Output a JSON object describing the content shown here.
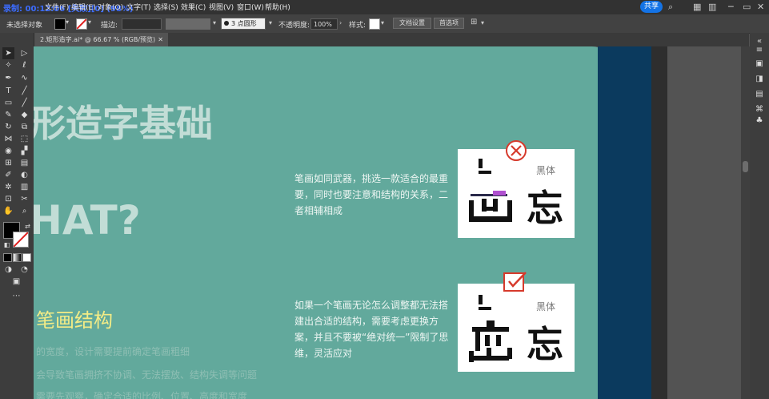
{
  "menubar": {
    "recording": "录制: 00:12:06 [失败][0] (98%)",
    "items": [
      "文件(F)",
      "编辑(E)",
      "对象(O)",
      "文字(T)",
      "选择(S)",
      "效果(C)",
      "视图(V)",
      "窗口(W)",
      "帮助(H)"
    ],
    "share": "共享"
  },
  "controlbar": {
    "selection": "未选择对象",
    "stroke_label": "描边:",
    "brush": "3 点圆形",
    "opacity_label": "不透明度:",
    "opacity": "100%",
    "style_label": "样式:",
    "doc_settings": "文档设置",
    "preferences": "首选项"
  },
  "tab": {
    "title": "2.矩形造字.ai* @ 66.67 % (RGB/预览)"
  },
  "artboard": {
    "title_fragment": "形造字基础",
    "what_fragment": "HAT?",
    "section_heading": "笔画结构",
    "faded_lines": [
      "的宽度，设计需要提前确定笔画粗细",
      "会导致笔画拥挤不协调、无法摆放、结构失调等问题",
      "需要先观察，确定合适的比例、位置、高度和宽度"
    ],
    "para1": "笔画如同武器，挑选一款适合的最重要，同时也要注意和结构的关系，二者相辅相成",
    "para2": "如果一个笔画无论怎么调整都无法搭建出合适的结构，需要考虑更换方案，并且不要被“绝对统一”限制了思维，灵活应对",
    "card1": {
      "label": "黑体",
      "char": "忘"
    },
    "card2": {
      "label": "黑体",
      "char": "忘"
    }
  },
  "colors": {
    "teal": "#62a99c",
    "navy": "#0b3a5e",
    "heading_yellow": "#f3ec86",
    "error_red": "#d63a2c"
  }
}
